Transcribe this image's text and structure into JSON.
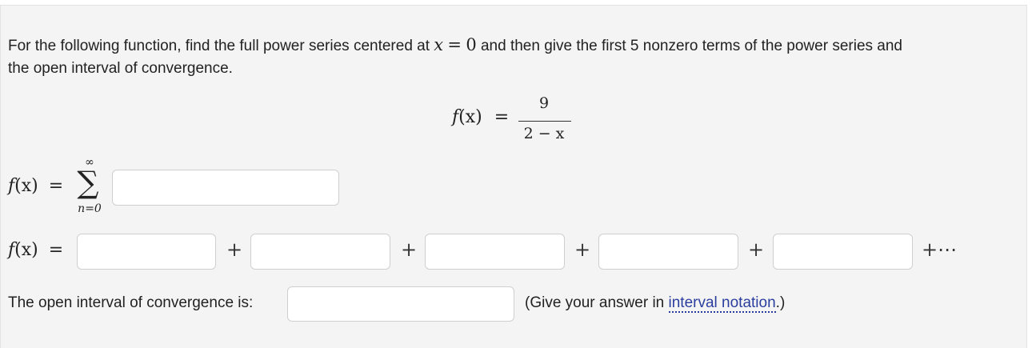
{
  "prompt": {
    "line1_before": "For the following function, find the full power series centered at",
    "line1_var": "x",
    "line1_eq": "=",
    "line1_zero": "0",
    "line1_after": "and then give the first 5 nonzero terms of the power series and",
    "line2": "the open interval of convergence."
  },
  "function": {
    "lhs_f": "f",
    "lhs_arg": "(x)",
    "eq": "=",
    "numerator": "9",
    "denominator": "2 − x"
  },
  "series_row": {
    "lhs_f": "f",
    "lhs_arg": "(x)",
    "eq": "=",
    "sigma": "∑",
    "upper": "∞",
    "lower": "n=0",
    "answer_value": ""
  },
  "terms_row": {
    "lhs_f": "f",
    "lhs_arg": "(x)",
    "eq": "=",
    "plus": "+",
    "tail": "+⋯",
    "term_values": [
      "",
      "",
      "",
      "",
      ""
    ]
  },
  "interval_row": {
    "label": "The open interval of convergence is:",
    "answer_value": "",
    "hint_before": "(Give your answer in",
    "hint_link": "interval notation",
    "hint_after": ".)"
  }
}
